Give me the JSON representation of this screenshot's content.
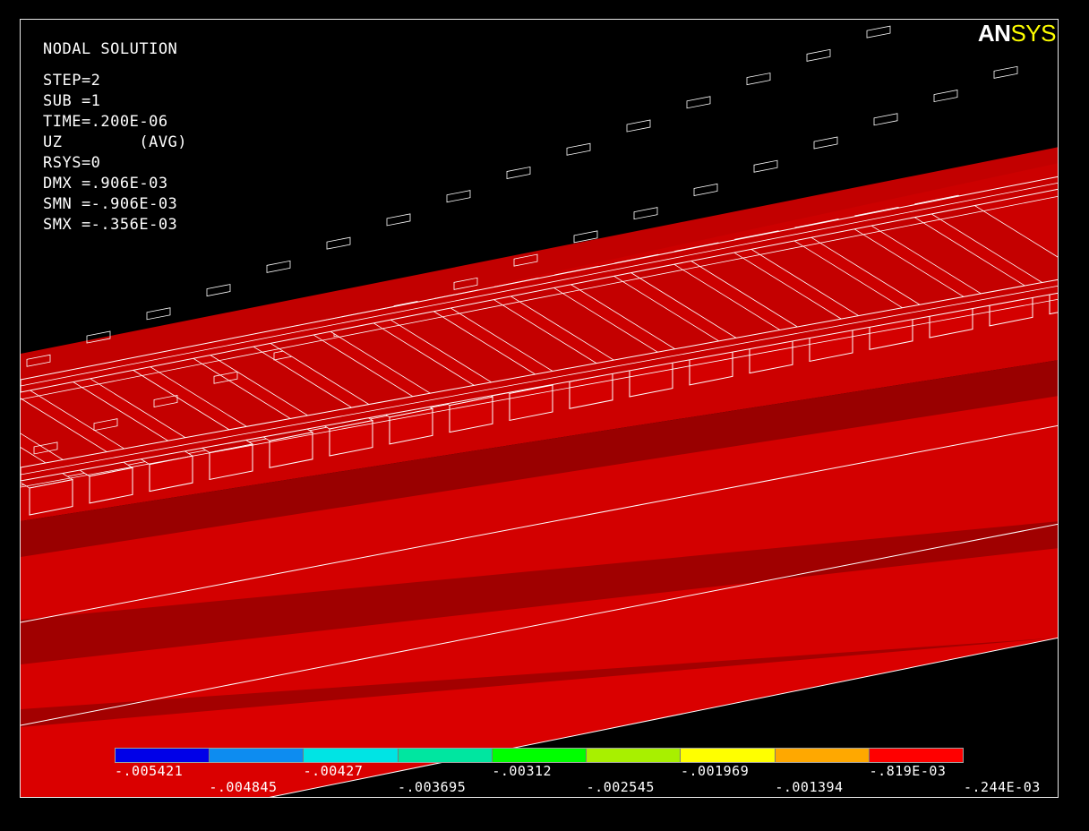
{
  "plot": {
    "title": "NODAL SOLUTION",
    "info_lines": [
      "STEP=2",
      "SUB =1",
      "TIME=.200E-06",
      "UZ        (AVG)",
      "RSYS=0",
      "DMX =.906E-03",
      "SMN =-.906E-03",
      "SMX =-.356E-03"
    ]
  },
  "logo": {
    "part1": "AN",
    "part2": "SYS"
  },
  "legend": {
    "colors": [
      "#0000e8",
      "#0d8cf0",
      "#00e4e4",
      "#00e6a0",
      "#00ff00",
      "#a8f000",
      "#ffff00",
      "#ffa800",
      "#ff0000"
    ],
    "upper_labels": [
      "-.005421",
      "-.00427",
      "-.00312",
      "-.001969",
      "-.819E-03"
    ],
    "lower_labels": [
      "-.004845",
      "-.003695",
      "-.002545",
      "-.001394",
      "-.244E-03"
    ]
  },
  "colors": {
    "background": "#000000",
    "model_red": "#d30000",
    "model_dark_red": "#8c0000",
    "edges": "#ffffff",
    "logo_sys": "#ffff00"
  }
}
